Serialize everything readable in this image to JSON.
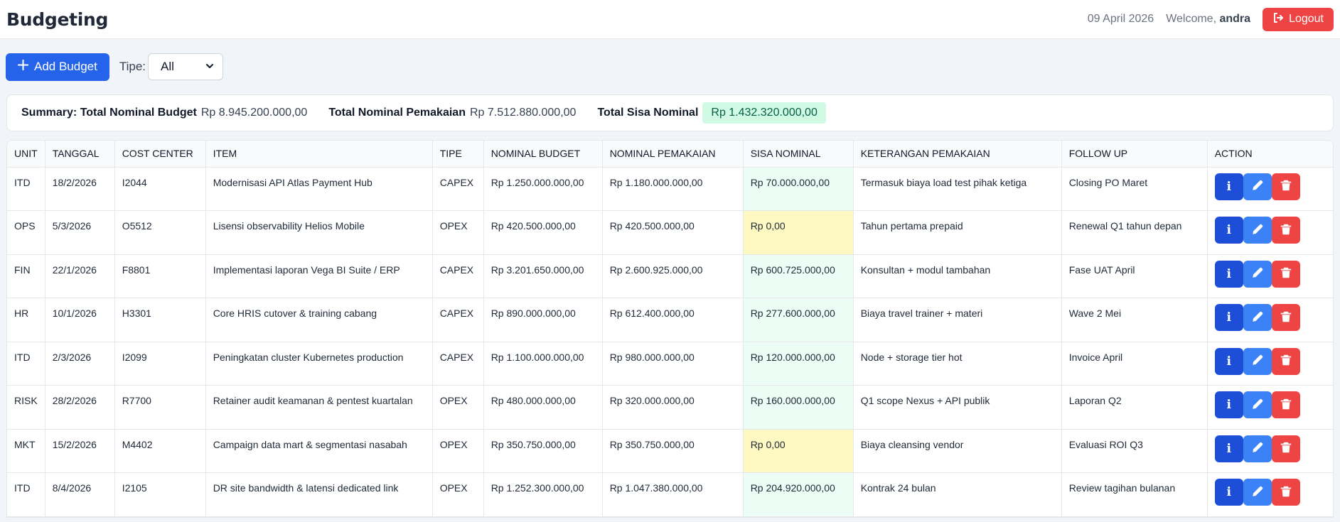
{
  "app": {
    "title": "Budgeting"
  },
  "header": {
    "date": "09 April 2026",
    "welcome": "Welcome,",
    "user": "andra",
    "logout_label": "Logout"
  },
  "toolbar": {
    "add_label": "Add Budget",
    "tipe_label": "Tipe:",
    "tipe_value": "All"
  },
  "summary": {
    "label_budget": "Summary: Total Nominal Budget",
    "total_budget": "Rp 8.945.200.000,00",
    "label_pemakaian": "Total Nominal Pemakaian",
    "total_pemakaian": "Rp 7.512.880.000,00",
    "label_sisa": "Total Sisa Nominal",
    "total_sisa": "Rp 1.432.320.000,00"
  },
  "table": {
    "headers": [
      "UNIT",
      "TANGGAL",
      "COST CENTER",
      "ITEM",
      "TIPE",
      "NOMINAL BUDGET",
      "NOMINAL PEMAKAIAN",
      "SISA NOMINAL",
      "KETERANGAN PEMAKAIAN",
      "FOLLOW UP",
      "ACTION"
    ],
    "rows": [
      {
        "unit": "ITD",
        "tanggal": "18/2/2026",
        "cost_center": "I2044",
        "item": "Modernisasi API Atlas Payment Hub",
        "tipe": "CAPEX",
        "budget": "Rp 1.250.000.000,00",
        "pemakaian": "Rp 1.180.000.000,00",
        "sisa": "Rp 70.000.000,00",
        "sisa_status": "ok",
        "keterangan": "Termasuk biaya load test pihak ketiga",
        "follow_up": "Closing PO Maret"
      },
      {
        "unit": "OPS",
        "tanggal": "5/3/2026",
        "cost_center": "O5512",
        "item": "Lisensi observability Helios Mobile",
        "tipe": "OPEX",
        "budget": "Rp 420.500.000,00",
        "pemakaian": "Rp 420.500.000,00",
        "sisa": "Rp 0,00",
        "sisa_status": "zero",
        "keterangan": "Tahun pertama prepaid",
        "follow_up": "Renewal Q1 tahun depan"
      },
      {
        "unit": "FIN",
        "tanggal": "22/1/2026",
        "cost_center": "F8801",
        "item": "Implementasi laporan Vega BI Suite / ERP",
        "tipe": "CAPEX",
        "budget": "Rp 3.201.650.000,00",
        "pemakaian": "Rp 2.600.925.000,00",
        "sisa": "Rp 600.725.000,00",
        "sisa_status": "ok",
        "keterangan": "Konsultan + modul tambahan",
        "follow_up": "Fase UAT April"
      },
      {
        "unit": "HR",
        "tanggal": "10/1/2026",
        "cost_center": "H3301",
        "item": "Core HRIS cutover & training cabang",
        "tipe": "CAPEX",
        "budget": "Rp 890.000.000,00",
        "pemakaian": "Rp 612.400.000,00",
        "sisa": "Rp 277.600.000,00",
        "sisa_status": "ok",
        "keterangan": "Biaya travel trainer + materi",
        "follow_up": "Wave 2 Mei"
      },
      {
        "unit": "ITD",
        "tanggal": "2/3/2026",
        "cost_center": "I2099",
        "item": "Peningkatan cluster Kubernetes production",
        "tipe": "CAPEX",
        "budget": "Rp 1.100.000.000,00",
        "pemakaian": "Rp 980.000.000,00",
        "sisa": "Rp 120.000.000,00",
        "sisa_status": "ok",
        "keterangan": "Node + storage tier hot",
        "follow_up": "Invoice April"
      },
      {
        "unit": "RISK",
        "tanggal": "28/2/2026",
        "cost_center": "R7700",
        "item": "Retainer audit keamanan & pentest kuartalan",
        "tipe": "OPEX",
        "budget": "Rp 480.000.000,00",
        "pemakaian": "Rp 320.000.000,00",
        "sisa": "Rp 160.000.000,00",
        "sisa_status": "ok",
        "keterangan": "Q1 scope Nexus + API publik",
        "follow_up": "Laporan Q2"
      },
      {
        "unit": "MKT",
        "tanggal": "15/2/2026",
        "cost_center": "M4402",
        "item": "Campaign data mart & segmentasi nasabah",
        "tipe": "OPEX",
        "budget": "Rp 350.750.000,00",
        "pemakaian": "Rp 350.750.000,00",
        "sisa": "Rp 0,00",
        "sisa_status": "zero",
        "keterangan": "Biaya cleansing vendor",
        "follow_up": "Evaluasi ROI Q3"
      },
      {
        "unit": "ITD",
        "tanggal": "8/4/2026",
        "cost_center": "I2105",
        "item": "DR site bandwidth & latensi dedicated link",
        "tipe": "OPEX",
        "budget": "Rp 1.252.300.000,00",
        "pemakaian": "Rp 1.047.380.000,00",
        "sisa": "Rp 204.920.000,00",
        "sisa_status": "ok",
        "keterangan": "Kontrak 24 bulan",
        "follow_up": "Review tagihan bulanan"
      }
    ],
    "action_icons": [
      "info-icon",
      "pencil-icon",
      "trash-icon"
    ],
    "info_glyph": "i"
  },
  "colors": {
    "primary": "#2563eb",
    "danger": "#ef4444",
    "sisa_ok_bg": "#ecfdf5",
    "sisa_zero_bg": "#fef9c3"
  }
}
